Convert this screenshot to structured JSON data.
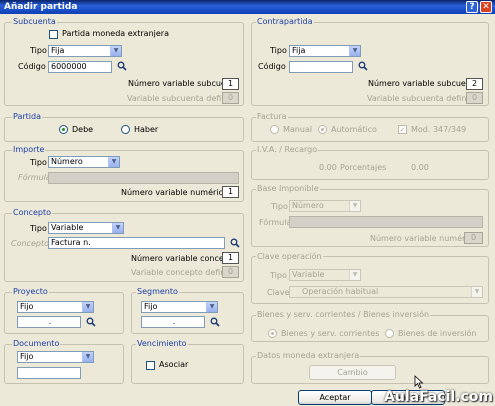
{
  "window": {
    "title": "Añadir partida",
    "help_label": "?",
    "close_label": "✕"
  },
  "subcuenta": {
    "title": "Subcuenta",
    "foreign_currency_label": "Partida moneda extranjera",
    "tipo_label": "Tipo",
    "tipo_value": "Fija",
    "codigo_label": "Código",
    "codigo_value": "6000000",
    "numero_variable_label": "Número variable subcuenta",
    "numero_variable_value": "1",
    "variable_definida_label": "Variable subcuenta definida",
    "variable_definida_value": "0"
  },
  "contrapartida": {
    "title": "Contrapartida",
    "tipo_label": "Tipo",
    "tipo_value": "Fija",
    "codigo_label": "Código",
    "codigo_value": "",
    "numero_variable_label": "Número variable subcuenta",
    "numero_variable_value": "2",
    "variable_definida_label": "Variable subcuenta definida",
    "variable_definida_value": "0"
  },
  "partida": {
    "title": "Partida",
    "debe_label": "Debe",
    "haber_label": "Haber"
  },
  "importe": {
    "title": "Importe",
    "tipo_label": "Tipo",
    "tipo_value": "Número",
    "formula_label": "Fórmula",
    "formula_value": "",
    "numero_variable_label": "Número variable numérica",
    "numero_variable_value": "1"
  },
  "concepto": {
    "title": "Concepto",
    "tipo_label": "Tipo",
    "tipo_value": "Variable",
    "concepto_label": "Concepto",
    "concepto_value": "Factura n.",
    "numero_variable_label": "Número variable concepto",
    "numero_variable_value": "1",
    "variable_definida_label": "Variable concepto definida",
    "variable_definida_value": "0"
  },
  "proyecto": {
    "title": "Proyecto",
    "tipo_value": "Fijo",
    "codigo_value": "."
  },
  "segmento": {
    "title": "Segmento",
    "tipo_value": "Fijo",
    "codigo_value": "."
  },
  "documento": {
    "title": "Documento",
    "tipo_value": "Fijo",
    "codigo_value": ""
  },
  "vencimiento": {
    "title": "Vencimiento",
    "asociar_label": "Asociar"
  },
  "factura": {
    "title": "Factura",
    "manual_label": "Manual",
    "automatico_label": "Automático",
    "mod_label": "Mod. 347/349"
  },
  "iva_recargo": {
    "title": "I.V.A. / Recargo",
    "iva_value": "0.00",
    "porcentajes_label": "Porcentajes",
    "porcentajes_value": "0.00"
  },
  "base_imponible": {
    "title": "Base Imponible",
    "tipo_label": "Tipo",
    "tipo_value": "Número",
    "formula_label": "Fórmula",
    "numero_variable_label": "Número variable numérica",
    "numero_variable_value": "0"
  },
  "clave_operacion": {
    "title": "Clave operación",
    "tipo_label": "Tipo",
    "tipo_value": "Variable",
    "clave_label": "Clave",
    "clave_value": "Operación habitual"
  },
  "bienes": {
    "title": "Bienes y serv. corrientes / Bienes inversión",
    "corrientes_label": "Bienes y serv. corrientes",
    "inversion_label": "Bienes de inversión"
  },
  "moneda": {
    "title": "Datos moneda extranjera",
    "cambio_label": "Cambio"
  },
  "footer": {
    "aceptar_label": "Aceptar",
    "cancelar_label": "Cancelar"
  },
  "watermark": "AulaFacil.com"
}
